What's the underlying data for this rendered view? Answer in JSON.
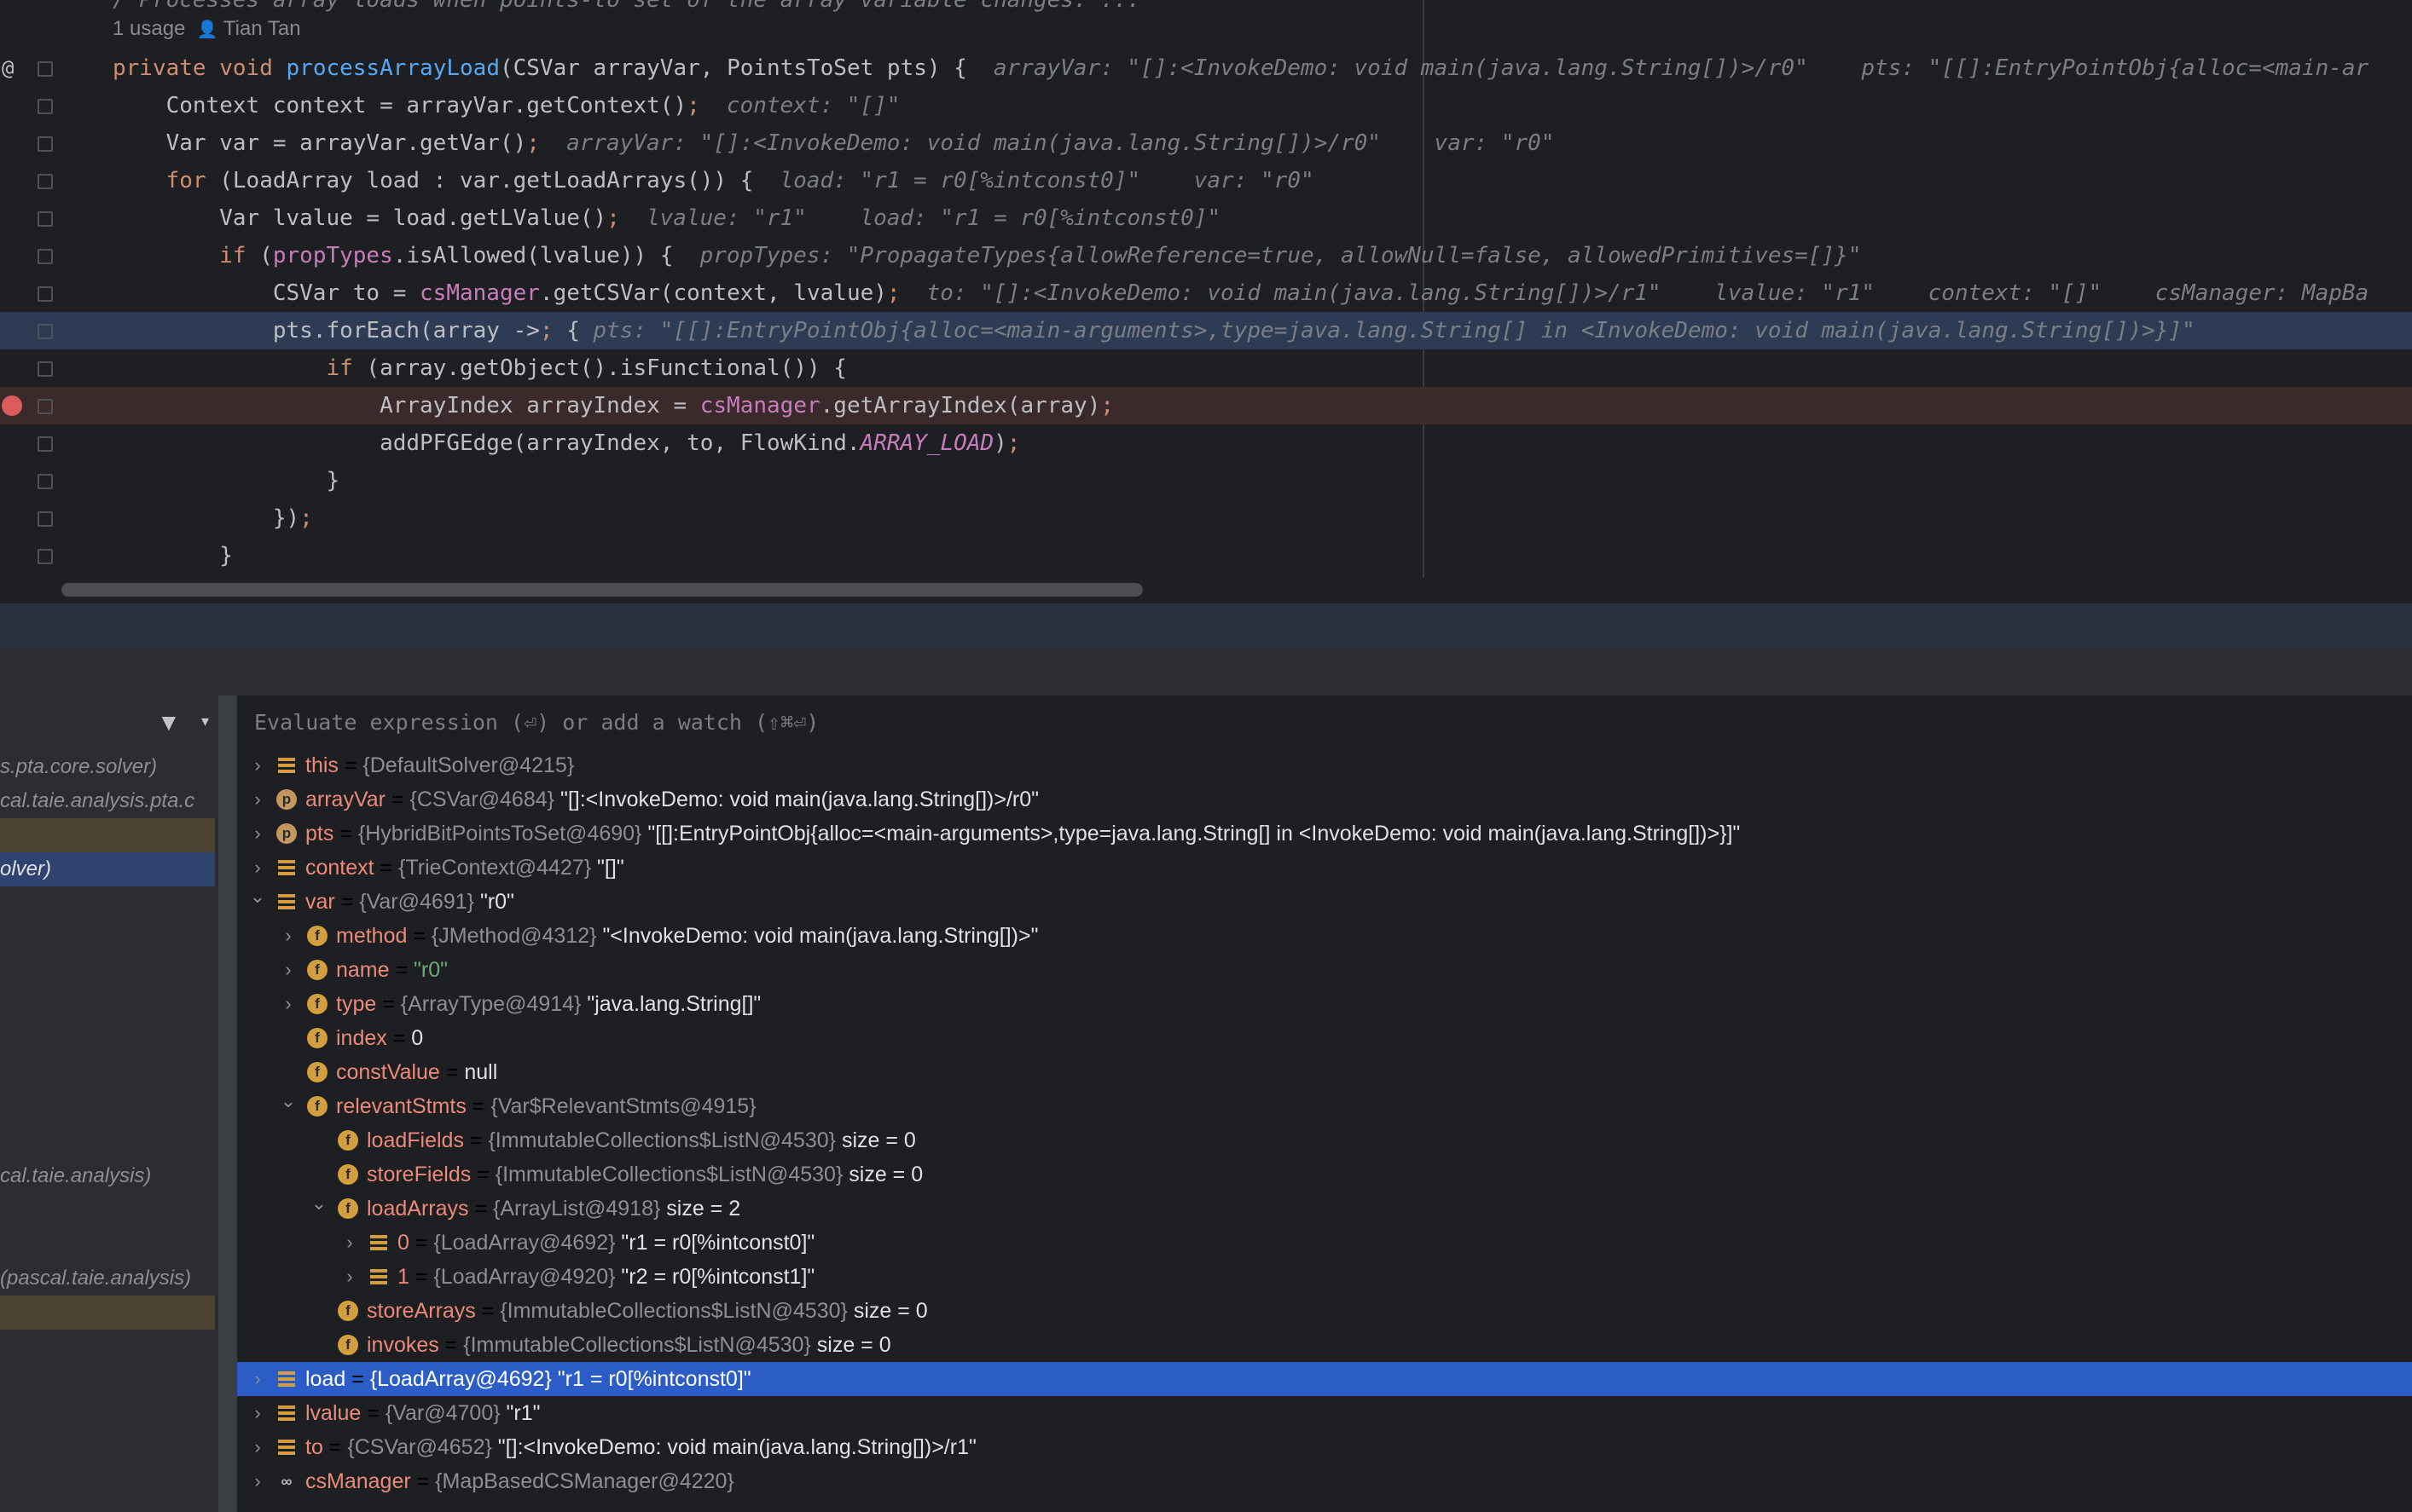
{
  "editor": {
    "usage_text": "1 usage",
    "author": "Tian Tan",
    "lines": [
      {
        "code": "private void processArrayLoad(CSVar arrayVar, PointsToSet pts) {",
        "hint": "arrayVar: \"[]:<InvokeDemo: void main(java.lang.String[])>/r0\"    pts: \"[[]:EntryPointObj{alloc=<main-ar"
      },
      {
        "code": "    Context context = arrayVar.getContext();",
        "hint": "context: \"[]\""
      },
      {
        "code": "    Var var = arrayVar.getVar();",
        "hint": "arrayVar: \"[]:<InvokeDemo: void main(java.lang.String[])>/r0\"    var: \"r0\""
      },
      {
        "code": "    for (LoadArray load : var.getLoadArrays()) {",
        "hint": "load: \"r1 = r0[%intconst0]\"    var: \"r0\""
      },
      {
        "code": "        Var lvalue = load.getLValue();",
        "hint": "lvalue: \"r1\"    load: \"r1 = r0[%intconst0]\""
      },
      {
        "code": "        if (propTypes.isAllowed(lvalue)) {",
        "hint": "propTypes: \"PropagateTypes{allowReference=true, allowNull=false, allowedPrimitives=[]}\""
      },
      {
        "code": "            CSVar to = csManager.getCSVar(context, lvalue);",
        "hint": "to: \"[]:<InvokeDemo: void main(java.lang.String[])>/r1\"    lvalue: \"r1\"    context: \"[]\"    csManager: MapBa"
      },
      {
        "code": "            pts.forEach(array -> {",
        "hint": "pts: \"[[]:EntryPointObj{alloc=<main-arguments>,type=java.lang.String[] in <InvokeDemo: void main(java.lang.String[])>}]\""
      },
      {
        "code": "                if (array.getObject().isFunctional()) {",
        "hint": ""
      },
      {
        "code": "                    ArrayIndex arrayIndex = csManager.getArrayIndex(array);",
        "hint": ""
      },
      {
        "code": "                    addPFGEdge(arrayIndex, to, FlowKind.ARRAY_LOAD);",
        "hint": ""
      },
      {
        "code": "                }",
        "hint": ""
      },
      {
        "code": "            });",
        "hint": ""
      },
      {
        "code": "        }",
        "hint": ""
      }
    ]
  },
  "debugger": {
    "eval_placeholder": "Evaluate expression (⏎) or add a watch (⇧⌘⏎)",
    "frames": [
      "s.pta.core.solver)",
      "cal.taie.analysis.pta.c",
      "",
      "olver)",
      "cal.taie.analysis)",
      "(pascal.taie.analysis)"
    ],
    "variables": [
      {
        "name": "this",
        "type": "{DefaultSolver@4215}",
        "value": "",
        "icon": "list-icon",
        "depth": 0,
        "expand": "collapsed"
      },
      {
        "name": "arrayVar",
        "type": "{CSVar@4684}",
        "value": "\"[]:<InvokeDemo: void main(java.lang.String[])>/r0\"",
        "icon": "param-icon",
        "depth": 0,
        "expand": "collapsed"
      },
      {
        "name": "pts",
        "type": "{HybridBitPointsToSet@4690}",
        "value": "\"[[]:EntryPointObj{alloc=<main-arguments>,type=java.lang.String[] in <InvokeDemo: void main(java.lang.String[])>}]\"",
        "icon": "param-icon",
        "depth": 0,
        "expand": "collapsed"
      },
      {
        "name": "context",
        "type": "{TrieContext@4427}",
        "value": "\"[]\"",
        "icon": "list-icon",
        "depth": 0,
        "expand": "collapsed"
      },
      {
        "name": "var",
        "type": "{Var@4691}",
        "value": "\"r0\"",
        "icon": "list-icon",
        "depth": 0,
        "expand": "expanded"
      },
      {
        "name": "method",
        "type": "{JMethod@4312}",
        "value": "\"<InvokeDemo: void main(java.lang.String[])>\"",
        "icon": "field-icon",
        "depth": 1,
        "expand": "collapsed"
      },
      {
        "name": "name",
        "type": "",
        "value": "\"r0\"",
        "icon": "field-icon",
        "depth": 1,
        "expand": "collapsed"
      },
      {
        "name": "type",
        "type": "{ArrayType@4914}",
        "value": "\"java.lang.String[]\"",
        "icon": "field-icon",
        "depth": 1,
        "expand": "collapsed"
      },
      {
        "name": "index",
        "type": "",
        "value": "0",
        "icon": "field-icon",
        "depth": 1,
        "expand": "none"
      },
      {
        "name": "constValue",
        "type": "",
        "value": "null",
        "icon": "field-icon",
        "depth": 1,
        "expand": "none"
      },
      {
        "name": "relevantStmts",
        "type": "{Var$RelevantStmts@4915}",
        "value": "",
        "icon": "field-icon",
        "depth": 1,
        "expand": "expanded"
      },
      {
        "name": "loadFields",
        "type": "{ImmutableCollections$ListN@4530}",
        "value": "size = 0",
        "icon": "field-icon",
        "depth": 2,
        "expand": "none"
      },
      {
        "name": "storeFields",
        "type": "{ImmutableCollections$ListN@4530}",
        "value": "size = 0",
        "icon": "field-icon",
        "depth": 2,
        "expand": "none"
      },
      {
        "name": "loadArrays",
        "type": "{ArrayList@4918}",
        "value": "size = 2",
        "icon": "field-icon",
        "depth": 2,
        "expand": "expanded"
      },
      {
        "name": "0",
        "type": "{LoadArray@4692}",
        "value": "\"r1 = r0[%intconst0]\"",
        "icon": "list-icon",
        "depth": 3,
        "expand": "collapsed"
      },
      {
        "name": "1",
        "type": "{LoadArray@4920}",
        "value": "\"r2 = r0[%intconst1]\"",
        "icon": "list-icon",
        "depth": 3,
        "expand": "collapsed"
      },
      {
        "name": "storeArrays",
        "type": "{ImmutableCollections$ListN@4530}",
        "value": "size = 0",
        "icon": "field-icon",
        "depth": 2,
        "expand": "none"
      },
      {
        "name": "invokes",
        "type": "{ImmutableCollections$ListN@4530}",
        "value": "size = 0",
        "icon": "field-icon",
        "depth": 2,
        "expand": "none"
      },
      {
        "name": "load",
        "type": "{LoadArray@4692}",
        "value": "\"r1 = r0[%intconst0]\"",
        "icon": "list-icon",
        "depth": 0,
        "expand": "collapsed",
        "selected": true
      },
      {
        "name": "lvalue",
        "type": "{Var@4700}",
        "value": "\"r1\"",
        "icon": "list-icon",
        "depth": 0,
        "expand": "collapsed"
      },
      {
        "name": "to",
        "type": "{CSVar@4652}",
        "value": "\"[]:<InvokeDemo: void main(java.lang.String[])>/r1\"",
        "icon": "list-icon",
        "depth": 0,
        "expand": "collapsed"
      },
      {
        "name": "csManager",
        "type": "{MapBasedCSManager@4220}",
        "value": "",
        "icon": "watch-icon",
        "depth": 0,
        "expand": "collapsed"
      }
    ]
  },
  "colors": {
    "editor_bg": "#1e1f22",
    "exec_line": "#2e3b54",
    "breakpoint_line": "#3a2a2c",
    "selection": "#2c5cc5",
    "var_name": "#ec8a79",
    "keyword": "#cf8e6d"
  }
}
